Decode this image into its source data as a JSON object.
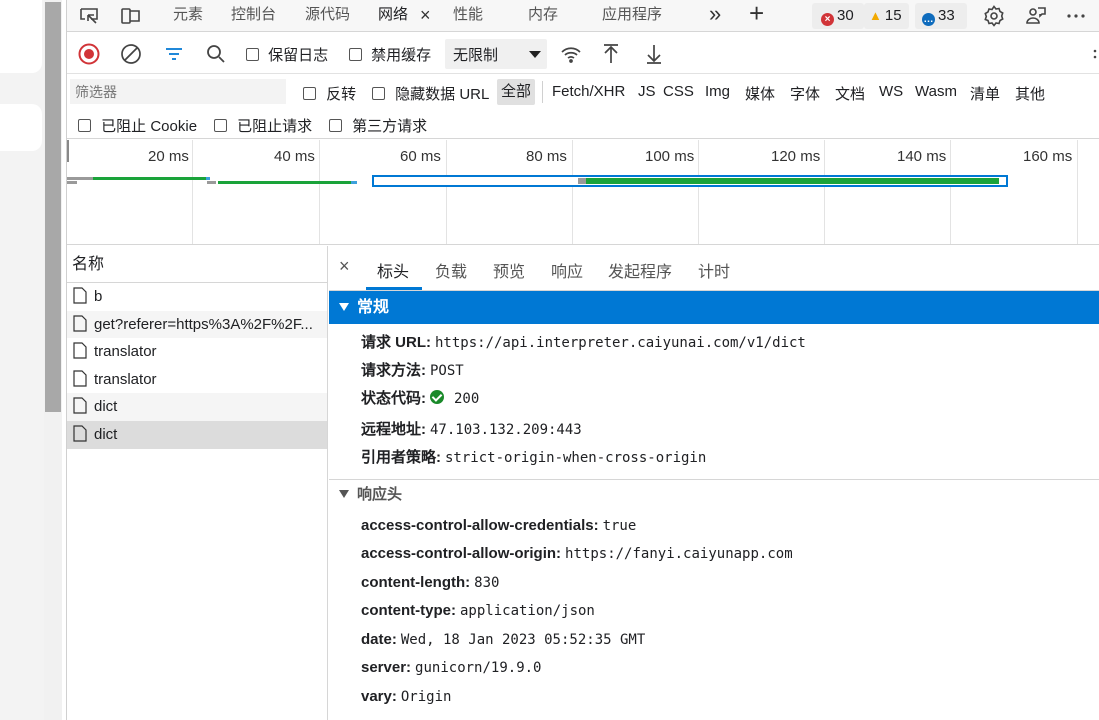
{
  "tabbar": {
    "tabs": [
      "元素",
      "控制台",
      "源代码",
      "网络",
      "性能",
      "内存",
      "应用程序"
    ],
    "active_tab": "网络",
    "close_symbol": "×",
    "more_tabs_symbol": "»",
    "add_symbol": "+",
    "errors": "30",
    "warnings": "15",
    "messages": "33"
  },
  "toolbar": {
    "preserve_log": "保留日志",
    "disable_cache": "禁用缓存",
    "throttling": "无限制"
  },
  "filter": {
    "placeholder": "筛选器",
    "invert": "反转",
    "hide_data_urls": "隐藏数据 URL",
    "types": [
      "全部",
      "Fetch/XHR",
      "JS",
      "CSS",
      "Img",
      "媒体",
      "字体",
      "文档",
      "WS",
      "Wasm",
      "清单",
      "其他"
    ],
    "active_type": "全部",
    "blocked_cookies": "已阻止 Cookie",
    "blocked_requests": "已阻止请求",
    "third_party": "第三方请求"
  },
  "overview": {
    "ticks": [
      "20 ms",
      "40 ms",
      "60 ms",
      "80 ms",
      "100 ms",
      "120 ms",
      "140 ms",
      "160 ms"
    ]
  },
  "requests": {
    "header": "名称",
    "items": [
      "b",
      "get?referer=https%3A%2F%2F...",
      "translator",
      "translator",
      "dict",
      "dict"
    ]
  },
  "details": {
    "close_symbol": "×",
    "tabs": [
      "标头",
      "负载",
      "预览",
      "响应",
      "发起程序",
      "计时"
    ],
    "active_tab": "标头",
    "general_title": "常规",
    "general": [
      {
        "key": "请求 URL:",
        "value": "https://api.interpreter.caiyunai.com/v1/dict"
      },
      {
        "key": "请求方法:",
        "value": "POST"
      },
      {
        "key": "状态代码:",
        "value": "200"
      },
      {
        "key": "远程地址:",
        "value": "47.103.132.209:443"
      },
      {
        "key": "引用者策略:",
        "value": "strict-origin-when-cross-origin"
      }
    ],
    "response_title": "响应头",
    "response_headers": [
      {
        "key": "access-control-allow-credentials:",
        "value": "true"
      },
      {
        "key": "access-control-allow-origin:",
        "value": "https://fanyi.caiyunapp.com"
      },
      {
        "key": "content-length:",
        "value": "830"
      },
      {
        "key": "content-type:",
        "value": "application/json"
      },
      {
        "key": "date:",
        "value": "Wed, 18 Jan 2023 05:52:35 GMT"
      },
      {
        "key": "server:",
        "value": "gunicorn/19.9.0"
      },
      {
        "key": "vary:",
        "value": "Origin"
      }
    ]
  },
  "colors": {
    "accent": "#0078d4",
    "error": "#d13438",
    "warning": "#f2a900",
    "info": "#0f6cbd",
    "record": "#d13438",
    "timeline_green": "#1aa33a",
    "timeline_blue": "#0078d4",
    "timeline_gray": "#9a9a9a"
  }
}
